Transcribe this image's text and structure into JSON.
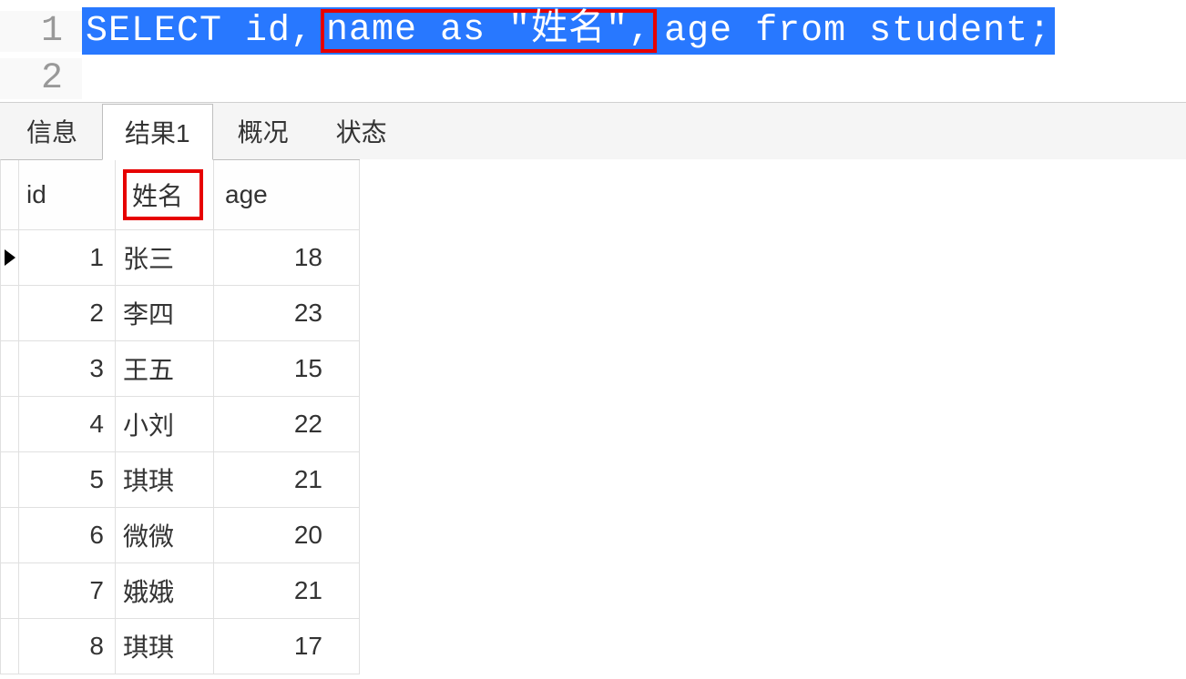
{
  "editor": {
    "lines": [
      {
        "number": "1",
        "sql_pre": "SELECT id,",
        "sql_box": "name as \"姓名\",",
        "sql_post": "age from student;"
      },
      {
        "number": "2",
        "sql_pre": "",
        "sql_box": "",
        "sql_post": ""
      }
    ]
  },
  "tabs": {
    "items": [
      {
        "label": "信息",
        "active": false
      },
      {
        "label": "结果1",
        "active": true
      },
      {
        "label": "概况",
        "active": false
      },
      {
        "label": "状态",
        "active": false
      }
    ]
  },
  "table": {
    "headers": {
      "id": "id",
      "name": "姓名",
      "age": "age"
    },
    "rows": [
      {
        "id": "1",
        "name": "张三",
        "age": "18",
        "current": true
      },
      {
        "id": "2",
        "name": "李四",
        "age": "23",
        "current": false
      },
      {
        "id": "3",
        "name": "王五",
        "age": "15",
        "current": false
      },
      {
        "id": "4",
        "name": "小刘",
        "age": "22",
        "current": false
      },
      {
        "id": "5",
        "name": "琪琪",
        "age": "21",
        "current": false
      },
      {
        "id": "6",
        "name": "微微",
        "age": "20",
        "current": false
      },
      {
        "id": "7",
        "name": "娥娥",
        "age": "21",
        "current": false
      },
      {
        "id": "8",
        "name": "琪琪",
        "age": "17",
        "current": false
      }
    ]
  }
}
